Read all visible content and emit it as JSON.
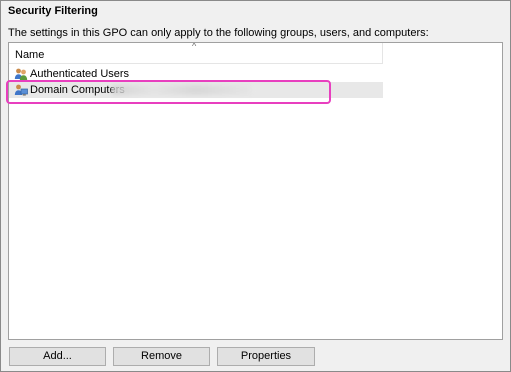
{
  "section": {
    "title": "Security Filtering",
    "description": "The settings in this GPO can only apply to the following groups, users, and computers:"
  },
  "list": {
    "column_name": "Name",
    "sort_indicator": "^",
    "items": [
      {
        "label": "Authenticated Users",
        "icon": "user-group-icon"
      },
      {
        "label": "Domain Computers",
        "icon": "computer-group-icon",
        "selected": true,
        "extra_text_obscured": true
      }
    ]
  },
  "buttons": {
    "add": "Add...",
    "remove": "Remove",
    "properties": "Properties"
  },
  "colors": {
    "highlight_annotation": "#e83fbf",
    "selected_row": "#e8e8e8"
  }
}
